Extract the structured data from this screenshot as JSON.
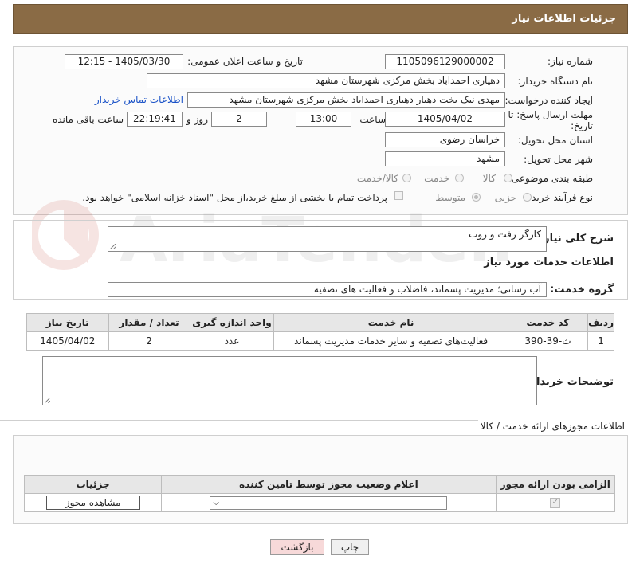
{
  "header": {
    "title": "جزئیات اطلاعات نیاز"
  },
  "fields": {
    "need_number_label": "شماره نیاز:",
    "need_number": "1105096129000002",
    "announce_label": "تاریخ و ساعت اعلان عمومی:",
    "announce_value": "1405/03/30 - 12:15",
    "buyer_org_label": "نام دستگاه خریدار:",
    "buyer_org": "دهیاری احمداباد بخش مرکزی شهرستان مشهد",
    "creator_label": "ایجاد کننده درخواست:",
    "creator": "مهدی نیک بخت دهیار دهیاری احمداباد بخش مرکزی شهرستان مشهد",
    "contact_link": "اطلاعات تماس خریدار",
    "deadline_label": "مهلت ارسال پاسخ: تا تاریخ:",
    "deadline_date": "1405/04/02",
    "time_label": "ساعت",
    "deadline_time": "13:00",
    "days_value": "2",
    "days_label": "روز و",
    "remaining_time": "22:19:41",
    "remaining_label": "ساعت باقی مانده",
    "province_label": "استان محل تحویل:",
    "province": "خراسان رضوی",
    "city_label": "شهر محل تحویل:",
    "city": "مشهد",
    "category_label": "طبقه بندی موضوعی:",
    "category_options": [
      "کالا",
      "خدمت",
      "کالا/خدمت"
    ],
    "process_label": "نوع فرآیند خرید :",
    "process_options": [
      "جزیی",
      "متوسط"
    ],
    "payment_note": "پرداخت تمام یا بخشی از مبلغ خرید،از محل \"اسناد خزانه اسلامی\" خواهد بود."
  },
  "summary": {
    "label": "شرح کلی نیاز:",
    "value": "کارگر رفت و روب"
  },
  "services": {
    "section_title": "اطلاعات خدمات مورد نیاز",
    "group_label": "گروه خدمت:",
    "group_value": "آب رسانی؛ مدیریت پسماند، فاضلاب و فعالیت های تصفیه",
    "columns": [
      "ردیف",
      "کد خدمت",
      "نام خدمت",
      "واحد اندازه گیری",
      "تعداد / مقدار",
      "تاریخ نیاز"
    ],
    "rows": [
      [
        "1",
        "ث-39-390",
        "فعالیت‌های تصفیه و سایر خدمات مدیریت پسماند",
        "عدد",
        "2",
        "1405/04/02"
      ]
    ]
  },
  "buyer_notes": {
    "label": "توضیحات خریدار:",
    "value": ""
  },
  "permits": {
    "section_title": "اطلاعات مجوزهای ارائه خدمت / کالا",
    "columns": [
      "الزامی بودن ارائه مجوز",
      "اعلام وضعیت مجوز توسط تامین کننده",
      "جزئیات"
    ],
    "select_value": "--",
    "view_button": "مشاهده مجوز"
  },
  "buttons": {
    "print": "چاپ",
    "back": "بازگشت"
  },
  "watermark": {
    "text": "AriaTender.neT"
  },
  "colors": {
    "header_bg": "#8a6b45",
    "link": "#1a52c7",
    "back_btn_bg": "#f7d9d9"
  }
}
